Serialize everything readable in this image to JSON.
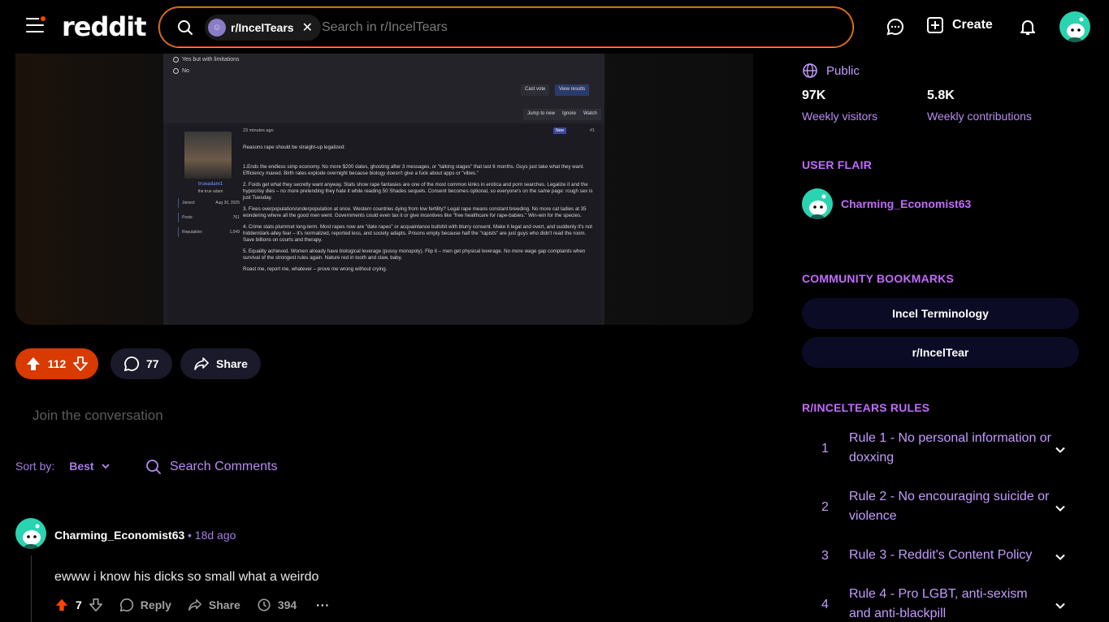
{
  "header": {
    "logo": "reddit",
    "search_chip": "r/IncelTears",
    "search_placeholder": "Search in r/IncelTears",
    "create_label": "Create"
  },
  "post_image": {
    "poll_options": [
      "Yes but with limitations",
      "No"
    ],
    "buttons": [
      "Cast vote",
      "View results",
      "Jump to new",
      "Ignore",
      "Watch"
    ],
    "post_time": "23 minutes ago",
    "badge": "New",
    "post_number": "#1",
    "username": "trueadam1",
    "user_title": "the true adam",
    "stats": [
      {
        "label": "Joined:",
        "value": "Aug 30, 2025"
      },
      {
        "label": "Posts:",
        "value": "761"
      },
      {
        "label": "Reputation:",
        "value": "1,049"
      }
    ],
    "paragraphs": [
      "Reasons rape should be straight-up legalized:",
      "1.Ends the endless simp economy. No more $200 dates, ghosting after 3 messages, or \"talking stages\" that last 6 months. Guys just take what they want. Efficiency maxed. Birth rates explode overnight because biology doesn't give a fuck about apps or \"vibes.\"",
      "2. Foids get what they secretly want anyway. Stats show rape fantasies are one of the most common kinks in erotica and porn searches. Legalize it and the hypocrisy dies – no more pretending they hate it while reading 50 Shades sequels. Consent becomes optional, so everyone's on the same page: rough sex is just Tuesday.",
      "3. Fixes overpopulation/underpopulation at once. Western countries dying from low fertility? Legal rape means constant breeding. No more cat ladies at 35 wondering where all the good men went. Governments could even tax it or give incentives like \"free healthcare for rape-babies.\" Win-win for the species.",
      "4. Crime stats plummet long-term. Most rapes now are \"date rapes\" or acquaintance bullshit with blurry consent. Make it legal and overt, and suddenly it's not hidden/dark-alley fear – it's normalized, reported less, and society adapts. Prisons empty because half the \"rapists\" are just guys who didn't read the room. Save billions on courts and therapy.",
      "5. Equality achieved. Women already have biological leverage (pussy monopoly). Flip it – men get physical leverage. No more wage gap complaints when survival of the strongest rules again. Nature red in tooth and claw, baby.",
      "Roast me, report me, whatever – prove me wrong without crying."
    ]
  },
  "actions": {
    "votes": "112",
    "comments": "77",
    "share": "Share"
  },
  "join_placeholder": "Join the conversation",
  "sort": {
    "label": "Sort by:",
    "value": "Best",
    "search_comments": "Search Comments"
  },
  "comment": {
    "user": "Charming_Economist63",
    "time": "• 18d ago",
    "body": "ewww i know his dicks so small what a weirdo",
    "votes": "7",
    "reply": "Reply",
    "share": "Share",
    "awards": "394"
  },
  "sidebar": {
    "visibility": "Public",
    "weekly_visitors_value": "97K",
    "weekly_visitors_label": "Weekly visitors",
    "weekly_contrib_value": "5.8K",
    "weekly_contrib_label": "Weekly contributions",
    "user_flair_heading": "USER FLAIR",
    "flair_user": "Charming_Economist63",
    "bookmarks_heading": "COMMUNITY BOOKMARKS",
    "bookmarks": [
      "Incel Terminology",
      "r/IncelTear"
    ],
    "rules_heading": "R/INCELTEARS RULES",
    "rules": [
      {
        "num": "1",
        "text": "Rule 1 - No personal information or doxxing"
      },
      {
        "num": "2",
        "text": "Rule 2 - No encouraging suicide or violence"
      },
      {
        "num": "3",
        "text": "Rule 3 - Reddit's Content Policy"
      },
      {
        "num": "4",
        "text": "Rule 4 - Pro LGBT, anti-sexism and anti-blackpill"
      }
    ]
  },
  "colors": {
    "accent": "#c26bff",
    "upvote": "#d93a00",
    "search_border": "#f6a21d"
  }
}
